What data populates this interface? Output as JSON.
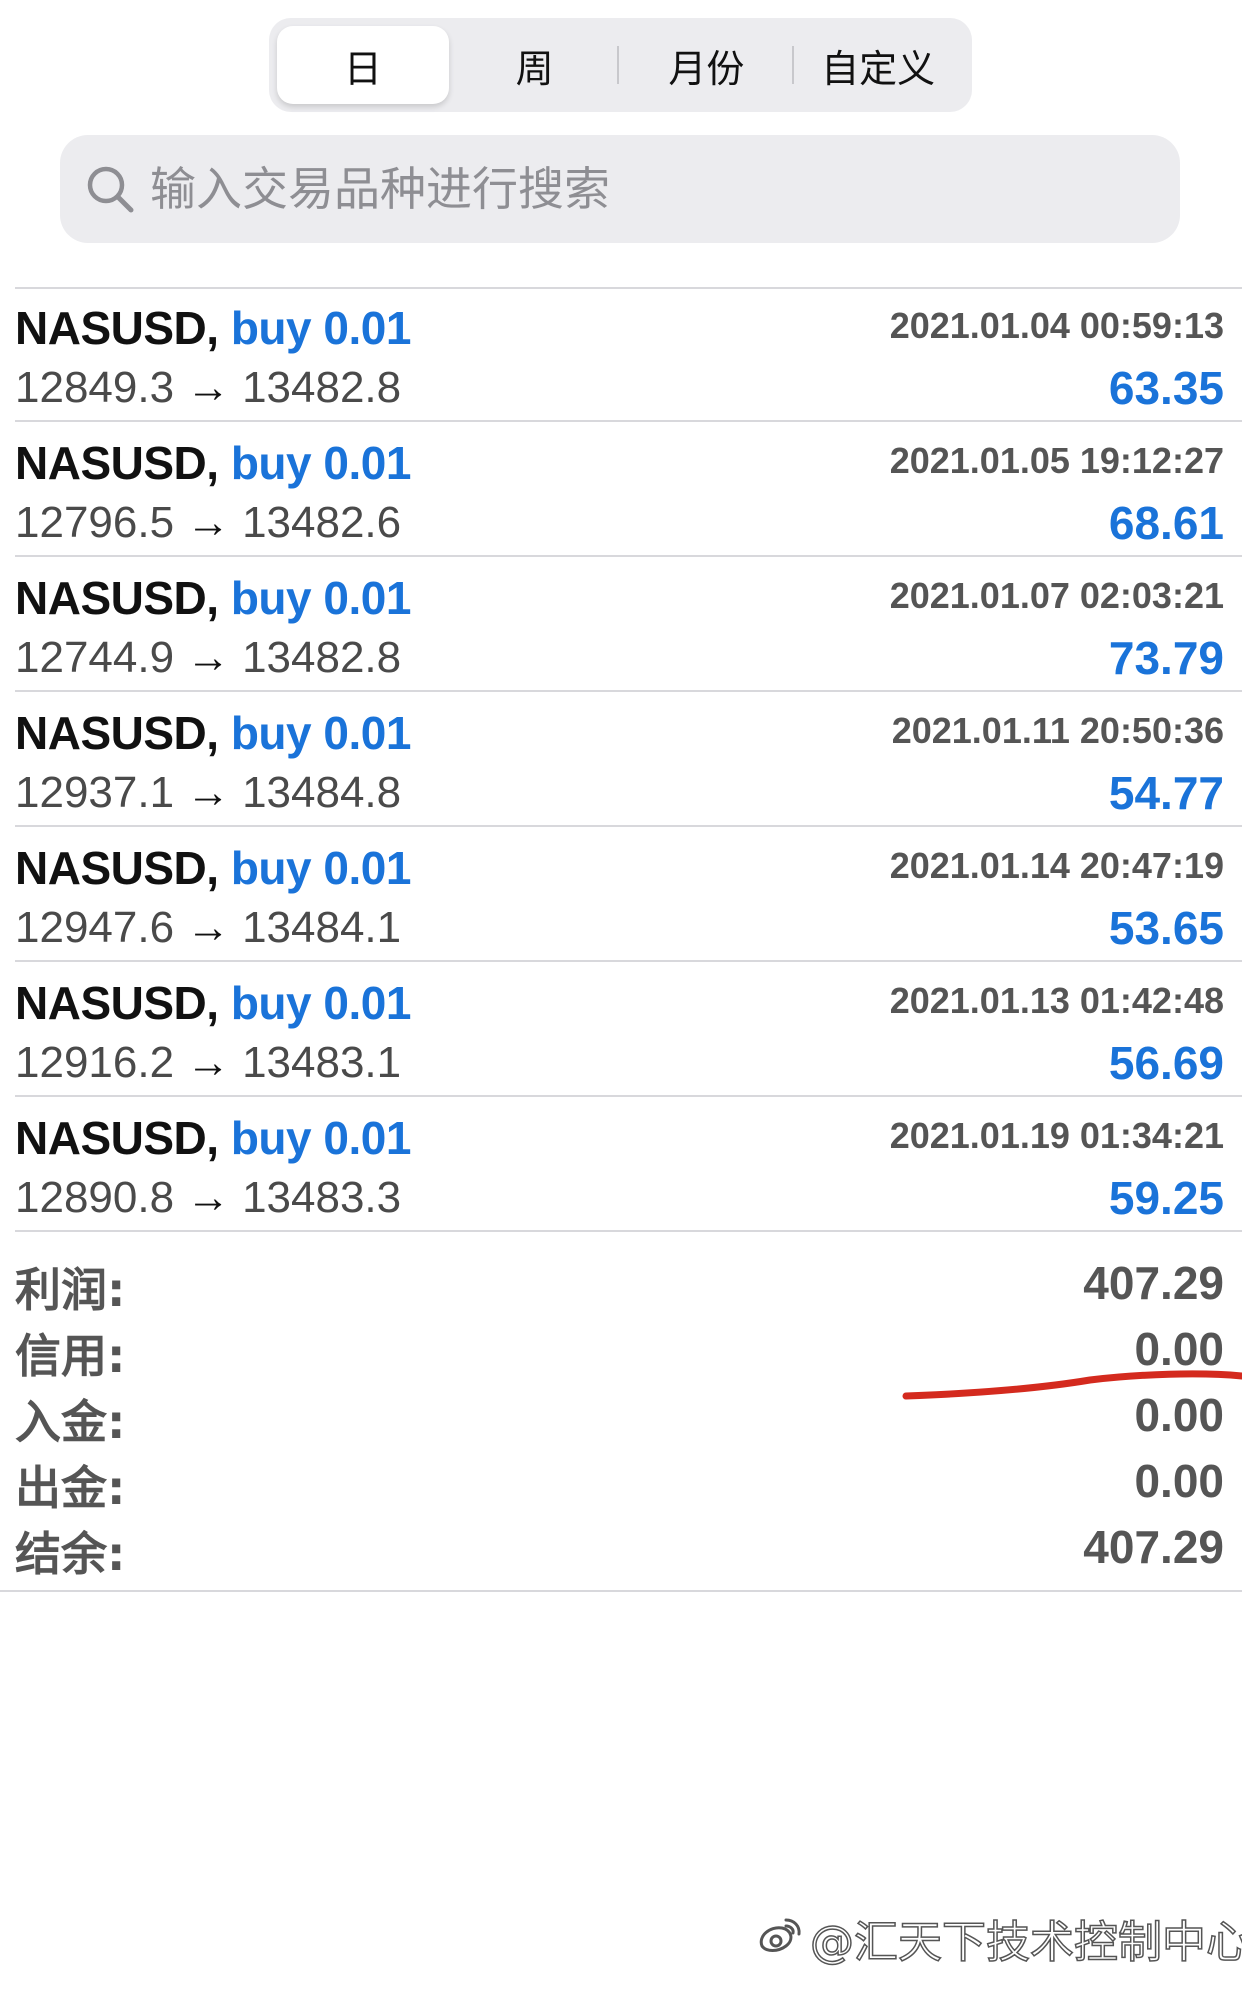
{
  "tabs": [
    {
      "label": "日",
      "active": true
    },
    {
      "label": "周",
      "active": false
    },
    {
      "label": "月份",
      "active": false
    },
    {
      "label": "自定义",
      "active": false
    }
  ],
  "search": {
    "placeholder": "输入交易品种进行搜索",
    "value": ""
  },
  "trades": [
    {
      "symbol": "NASUSD,",
      "type_lots": "buy 0.01",
      "time": "2021.01.04 00:59:13",
      "open": "12849.3",
      "close": "13482.8",
      "arrow": "→",
      "profit": "63.35"
    },
    {
      "symbol": "NASUSD,",
      "type_lots": "buy 0.01",
      "time": "2021.01.05 19:12:27",
      "open": "12796.5",
      "close": "13482.6",
      "arrow": "→",
      "profit": "68.61"
    },
    {
      "symbol": "NASUSD,",
      "type_lots": "buy 0.01",
      "time": "2021.01.07 02:03:21",
      "open": "12744.9",
      "close": "13482.8",
      "arrow": "→",
      "profit": "73.79"
    },
    {
      "symbol": "NASUSD,",
      "type_lots": "buy 0.01",
      "time": "2021.01.11 20:50:36",
      "open": "12937.1",
      "close": "13484.8",
      "arrow": "→",
      "profit": "54.77"
    },
    {
      "symbol": "NASUSD,",
      "type_lots": "buy 0.01",
      "time": "2021.01.14 20:47:19",
      "open": "12947.6",
      "close": "13484.1",
      "arrow": "→",
      "profit": "53.65"
    },
    {
      "symbol": "NASUSD,",
      "type_lots": "buy 0.01",
      "time": "2021.01.13 01:42:48",
      "open": "12916.2",
      "close": "13483.1",
      "arrow": "→",
      "profit": "56.69"
    },
    {
      "symbol": "NASUSD,",
      "type_lots": "buy 0.01",
      "time": "2021.01.19 01:34:21",
      "open": "12890.8",
      "close": "13483.3",
      "arrow": "→",
      "profit": "59.25"
    }
  ],
  "summary": [
    {
      "label": "利润:",
      "value": "407.29"
    },
    {
      "label": "信用:",
      "value": "0.00"
    },
    {
      "label": "入金:",
      "value": "0.00"
    },
    {
      "label": "出金:",
      "value": "0.00"
    },
    {
      "label": "结余:",
      "value": "407.29"
    }
  ],
  "watermark": {
    "text": "@汇天下技术控制中心"
  },
  "colors": {
    "accent_blue": "#1a73d9",
    "annotation_red": "#d42a1e",
    "segment_bg": "#ececef"
  }
}
